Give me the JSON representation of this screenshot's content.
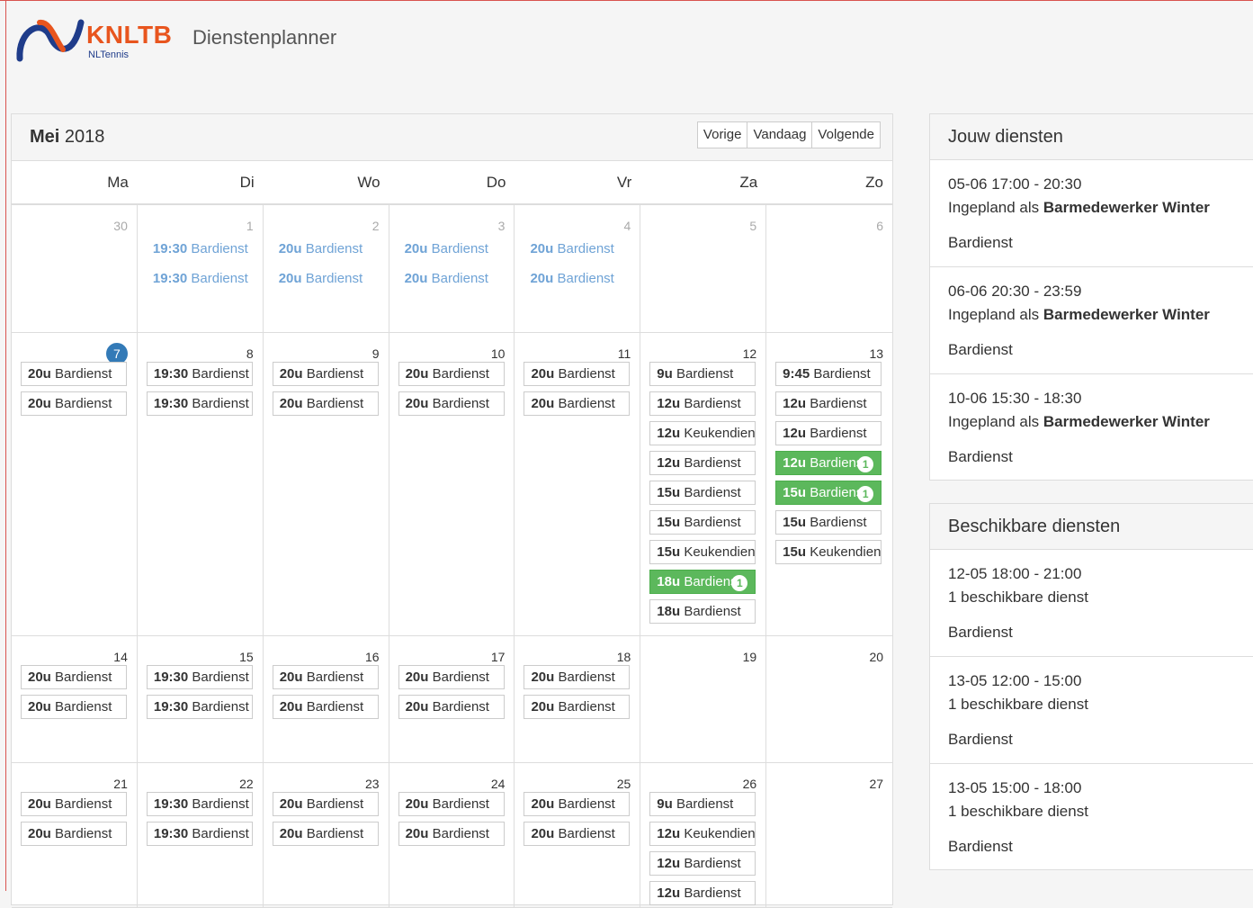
{
  "header": {
    "brand": "KNLTB",
    "brand_sub": "NLTennis",
    "app_title": "Dienstenplanner"
  },
  "calendar": {
    "month": "Mei",
    "year": "2018",
    "buttons": {
      "prev": "Vorige",
      "today": "Vandaag",
      "next": "Volgende"
    },
    "weekdays": [
      "Ma",
      "Di",
      "Wo",
      "Do",
      "Vr",
      "Za",
      "Zo"
    ],
    "weeks": [
      [
        {
          "num": "30",
          "muted": true,
          "events": []
        },
        {
          "num": "1",
          "muted": true,
          "events": [
            {
              "t": "19:30",
              "n": "Bardienst"
            },
            {
              "t": "19:30",
              "n": "Bardienst"
            }
          ]
        },
        {
          "num": "2",
          "muted": true,
          "events": [
            {
              "t": "20u",
              "n": "Bardienst"
            },
            {
              "t": "20u",
              "n": "Bardienst"
            }
          ]
        },
        {
          "num": "3",
          "muted": true,
          "events": [
            {
              "t": "20u",
              "n": "Bardienst"
            },
            {
              "t": "20u",
              "n": "Bardienst"
            }
          ]
        },
        {
          "num": "4",
          "muted": true,
          "events": [
            {
              "t": "20u",
              "n": "Bardienst"
            },
            {
              "t": "20u",
              "n": "Bardienst"
            }
          ]
        },
        {
          "num": "5",
          "muted": true,
          "events": []
        },
        {
          "num": "6",
          "muted": true,
          "events": []
        }
      ],
      [
        {
          "num": "7",
          "today": true,
          "events": [
            {
              "t": "20u",
              "n": "Bardienst"
            },
            {
              "t": "20u",
              "n": "Bardienst"
            }
          ]
        },
        {
          "num": "8",
          "events": [
            {
              "t": "19:30",
              "n": "Bardienst"
            },
            {
              "t": "19:30",
              "n": "Bardienst"
            }
          ]
        },
        {
          "num": "9",
          "events": [
            {
              "t": "20u",
              "n": "Bardienst"
            },
            {
              "t": "20u",
              "n": "Bardienst"
            }
          ]
        },
        {
          "num": "10",
          "events": [
            {
              "t": "20u",
              "n": "Bardienst"
            },
            {
              "t": "20u",
              "n": "Bardienst"
            }
          ]
        },
        {
          "num": "11",
          "events": [
            {
              "t": "20u",
              "n": "Bardienst"
            },
            {
              "t": "20u",
              "n": "Bardienst"
            }
          ]
        },
        {
          "num": "12",
          "events": [
            {
              "t": "9u",
              "n": "Bardienst"
            },
            {
              "t": "12u",
              "n": "Bardienst"
            },
            {
              "t": "12u",
              "n": "Keukendienst"
            },
            {
              "t": "12u",
              "n": "Bardienst"
            },
            {
              "t": "15u",
              "n": "Bardienst"
            },
            {
              "t": "15u",
              "n": "Bardienst"
            },
            {
              "t": "15u",
              "n": "Keukendienst"
            },
            {
              "t": "18u",
              "n": "Bardienst",
              "green": true,
              "count": "1"
            },
            {
              "t": "18u",
              "n": "Bardienst"
            }
          ]
        },
        {
          "num": "13",
          "events": [
            {
              "t": "9:45",
              "n": "Bardienst"
            },
            {
              "t": "12u",
              "n": "Bardienst"
            },
            {
              "t": "12u",
              "n": "Bardienst"
            },
            {
              "t": "12u",
              "n": "Bardienst",
              "green": true,
              "count": "1"
            },
            {
              "t": "15u",
              "n": "Bardienst",
              "green": true,
              "count": "1"
            },
            {
              "t": "15u",
              "n": "Bardienst"
            },
            {
              "t": "15u",
              "n": "Keukendienst"
            }
          ]
        }
      ],
      [
        {
          "num": "14",
          "events": [
            {
              "t": "20u",
              "n": "Bardienst"
            },
            {
              "t": "20u",
              "n": "Bardienst"
            }
          ]
        },
        {
          "num": "15",
          "events": [
            {
              "t": "19:30",
              "n": "Bardienst"
            },
            {
              "t": "19:30",
              "n": "Bardienst"
            }
          ]
        },
        {
          "num": "16",
          "events": [
            {
              "t": "20u",
              "n": "Bardienst"
            },
            {
              "t": "20u",
              "n": "Bardienst"
            }
          ]
        },
        {
          "num": "17",
          "events": [
            {
              "t": "20u",
              "n": "Bardienst"
            },
            {
              "t": "20u",
              "n": "Bardienst"
            }
          ]
        },
        {
          "num": "18",
          "events": [
            {
              "t": "20u",
              "n": "Bardienst"
            },
            {
              "t": "20u",
              "n": "Bardienst"
            }
          ]
        },
        {
          "num": "19",
          "events": []
        },
        {
          "num": "20",
          "events": []
        }
      ],
      [
        {
          "num": "21",
          "events": [
            {
              "t": "20u",
              "n": "Bardienst"
            },
            {
              "t": "20u",
              "n": "Bardienst"
            }
          ]
        },
        {
          "num": "22",
          "events": [
            {
              "t": "19:30",
              "n": "Bardienst"
            },
            {
              "t": "19:30",
              "n": "Bardienst"
            }
          ]
        },
        {
          "num": "23",
          "events": [
            {
              "t": "20u",
              "n": "Bardienst"
            },
            {
              "t": "20u",
              "n": "Bardienst"
            }
          ]
        },
        {
          "num": "24",
          "events": [
            {
              "t": "20u",
              "n": "Bardienst"
            },
            {
              "t": "20u",
              "n": "Bardienst"
            }
          ]
        },
        {
          "num": "25",
          "events": [
            {
              "t": "20u",
              "n": "Bardienst"
            },
            {
              "t": "20u",
              "n": "Bardienst"
            }
          ]
        },
        {
          "num": "26",
          "events": [
            {
              "t": "9u",
              "n": "Bardienst"
            },
            {
              "t": "12u",
              "n": "Keukendienst"
            },
            {
              "t": "12u",
              "n": "Bardienst"
            },
            {
              "t": "12u",
              "n": "Bardienst"
            }
          ]
        },
        {
          "num": "27",
          "events": []
        }
      ]
    ]
  },
  "my_shifts": {
    "title": "Jouw diensten",
    "items": [
      {
        "when": "05-06 17:00 - 20:30",
        "prefix": "Ingepland als",
        "role": "Barmedewerker Winter",
        "type": "Bardienst"
      },
      {
        "when": "06-06 20:30 - 23:59",
        "prefix": "Ingepland als",
        "role": "Barmedewerker Winter",
        "type": "Bardienst"
      },
      {
        "when": "10-06 15:30 - 18:30",
        "prefix": "Ingepland als",
        "role": "Barmedewerker Winter",
        "type": "Bardienst"
      }
    ]
  },
  "available_shifts": {
    "title": "Beschikbare diensten",
    "items": [
      {
        "when": "12-05 18:00 - 21:00",
        "avail": "1 beschikbare dienst",
        "type": "Bardienst"
      },
      {
        "when": "13-05 12:00 - 15:00",
        "avail": "1 beschikbare dienst",
        "type": "Bardienst"
      },
      {
        "when": "13-05 15:00 - 18:00",
        "avail": "1 beschikbare dienst",
        "type": "Bardienst"
      }
    ]
  },
  "colors": {
    "accent": "#337ab7",
    "brand": "#e8551e",
    "available": "#5cb85c"
  }
}
